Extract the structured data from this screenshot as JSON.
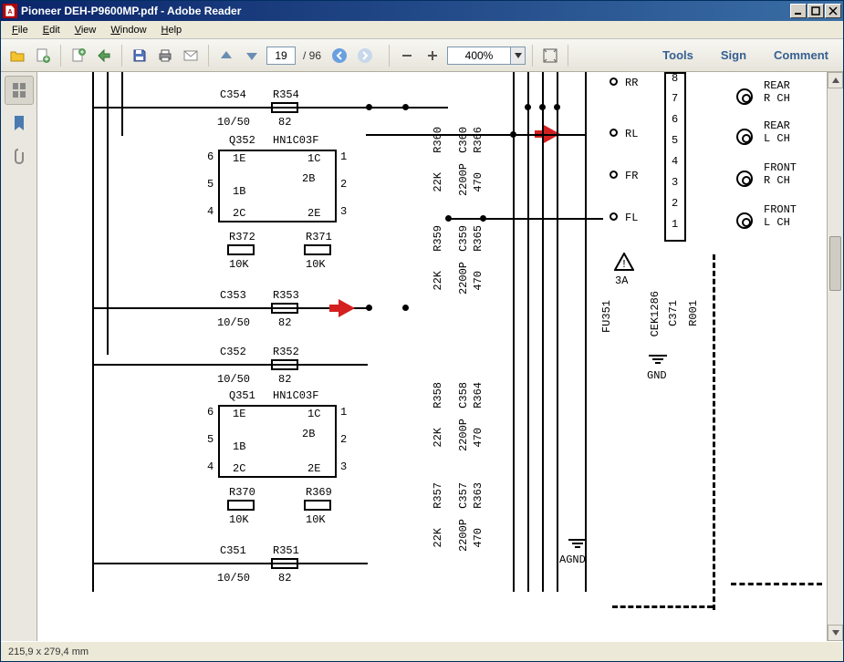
{
  "window": {
    "title": "Pioneer DEH-P9600MP.pdf - Adobe Reader"
  },
  "menu": {
    "file": "File",
    "edit": "Edit",
    "view": "View",
    "window": "Window",
    "help": "Help"
  },
  "toolbar": {
    "page_current": "19",
    "page_total": "/  96",
    "zoom": "400%",
    "tools": "Tools",
    "sign": "Sign",
    "comment": "Comment"
  },
  "status": {
    "dimensions": "215,9 x 279,4 mm"
  },
  "schematic": {
    "c354": "C354",
    "r354": "R354",
    "v1050_1": "10/50",
    "v82_1": "82",
    "q352": "Q352",
    "hn1c03f_1": "HN1C03F",
    "pin6_1": "6",
    "pin5_1": "5",
    "pin4_1": "4",
    "pin1_1": "1",
    "pin2_1": "2",
    "pin3_1": "3",
    "e1_1": "1E",
    "c1_1": "1C",
    "b2_1": "2B",
    "b1_1": "1B",
    "c2_1": "2C",
    "e2_1": "2E",
    "r372": "R372",
    "v10k_1": "10K",
    "r371": "R371",
    "v10k_2": "10K",
    "c353": "C353",
    "r353": "R353",
    "v1050_2": "10/50",
    "v82_2": "82",
    "c352": "C352",
    "r352": "R352",
    "v1050_3": "10/50",
    "v82_3": "82",
    "q351": "Q351",
    "hn1c03f_2": "HN1C03F",
    "r370": "R370",
    "v10k_3": "10K",
    "r369": "R369",
    "v10k_4": "10K",
    "c351": "C351",
    "r351": "R351",
    "v1050_4": "10/50",
    "v82_4": "82",
    "r360": "R360",
    "v22k_1": "22K",
    "c360": "C360",
    "r366": "R366",
    "v470_1": "470",
    "v2200p_1": "2200P",
    "r359": "R359",
    "v22k_2": "22K",
    "c359": "C359",
    "r365": "R365",
    "v470_2": "470",
    "v2200p_2": "2200P",
    "r358": "R358",
    "v22k_3": "22K",
    "c358": "C358",
    "r364": "R364",
    "v470_3": "470",
    "v2200p_3": "2200P",
    "r357": "R357",
    "v22k_4": "22K",
    "c357": "C357",
    "r363": "R363",
    "v470_4": "470",
    "v2200p_4": "2200P",
    "rr": "RR",
    "rl": "RL",
    "fr": "FR",
    "fl": "FL",
    "pin_8": "8",
    "pin_7": "7",
    "pin_6": "6",
    "pin_5": "5",
    "pin_4": "4",
    "pin_3": "3",
    "pin_2": "2",
    "pin_1": "1",
    "rear_rch": "REAR\nR CH",
    "rear_lch": "REAR\nL CH",
    "front_rch": "FRONT\nR CH",
    "front_lch": "FRONT\nL CH",
    "fu351": "FU351",
    "v3a": "3A",
    "cek1286": "CEK1286",
    "c371": "C371",
    "r001": "R001",
    "gnd": "GND",
    "agnd": "AGND"
  }
}
